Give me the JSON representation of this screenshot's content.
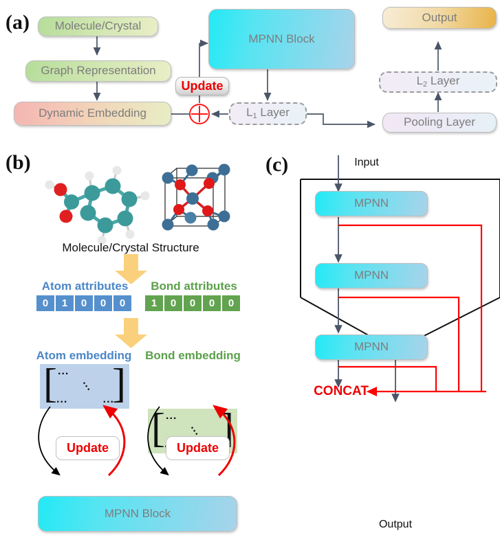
{
  "figure": {
    "panels": [
      "(a)",
      "(b)",
      "(c)"
    ]
  },
  "panel_a": {
    "letter": "(a)",
    "nodes": {
      "molecule_crystal": "Molecule/Crystal",
      "graph_representation": "Graph Representation",
      "dynamic_embedding": "Dynamic Embedding",
      "mpnn_block": "MPNN Block",
      "update": "Update",
      "l1_layer_prefix": "L",
      "l1_layer_sub": "1",
      "l1_layer_suffix": " Layer",
      "l2_layer_prefix": "L",
      "l2_layer_sub": "2",
      "l2_layer_suffix": " Layer",
      "pooling_layer": "Pooling Layer",
      "output": "Output"
    },
    "symbols": {
      "sum_operator": "plus-circle"
    },
    "colors": {
      "green_start": "#b6dd9a",
      "pink_start": "#f5b5b2",
      "cyan_start": "#22eaf5",
      "gold_end": "#e8b348",
      "lavender": "#f1e8f4",
      "arrow": "#4a5568",
      "update_text": "#ee0000",
      "box_text": "#7d7d7d"
    }
  },
  "panel_b": {
    "letter": "(b)",
    "structure_caption": "Molecule/Crystal Structure",
    "atom": {
      "attributes_title": "Atom attributes",
      "attributes": [
        "0",
        "1",
        "0",
        "0",
        "0"
      ],
      "embedding_title": "Atom embedding",
      "color": "#4a86c8",
      "cell_color": "#5590cd",
      "matrix_bg": "#bdd2ea"
    },
    "bond": {
      "attributes_title": "Bond attributes",
      "attributes": [
        "1",
        "0",
        "0",
        "0",
        "0"
      ],
      "embedding_title": "Bond embedding",
      "color": "#5ba04a",
      "cell_color": "#62a34f",
      "matrix_bg": "#cfe3bd"
    },
    "matrix_glyphs": {
      "top_dots": "...",
      "diag_dots": "...",
      "bottom_left_dots": "...",
      "bottom_right_dots": "..."
    },
    "update_atom": "Update",
    "update_bond": "Update",
    "mpnn_block": "MPNN Block",
    "colors": {
      "big_arrow": "#fbd07c",
      "feedback_arrow": "#ee0000",
      "forward_arrow": "#000000"
    }
  },
  "panel_c": {
    "letter": "(c)",
    "input": "Input",
    "output": "Output",
    "blocks": [
      "MPNN",
      "MPNN",
      "MPNN"
    ],
    "concat": "CONCAT",
    "colors": {
      "skip": "#ff0000",
      "flow": "#4a5568",
      "outline": "#111111",
      "block_start": "#22eaf5",
      "block_end": "#a8d3ea"
    }
  }
}
